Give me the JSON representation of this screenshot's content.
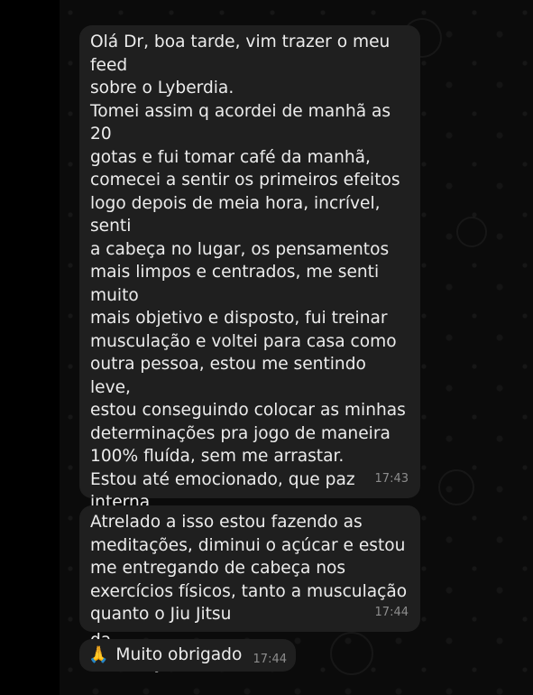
{
  "messages": [
    {
      "text": "Olá Dr, boa tarde, vim trazer o meu feed\nsobre o Lyberdia.\nTomei assim q acordei de manhã as 20\ngotas e fui tomar café da manhã,\ncomecei a sentir os primeiros efeitos\nlogo depois de meia hora, incrível, senti\na cabeça no lugar, os pensamentos\nmais limpos e centrados, me senti muito\nmais objetivo e disposto, fui treinar\nmusculação e voltei para casa como\noutra pessoa, estou me sentindo leve,\nestou conseguindo colocar as minhas\ndeterminações pra jogo de maneira\n100% fluída, sem me arrastar.\nEstou até emocionado, que paz interna\nestou sentindo agora, estou pleno e\nfocado, parece que estava faltando uma\npecinha nas engrenagens do meu\ncérebro. Muito feliz com o resultado da\nmedicação",
      "time": "17:43"
    },
    {
      "text": "Atrelado a isso estou fazendo as\nmeditações,  diminui o açúcar e estou\nme entregando de cabeça nos\nexercícios físicos, tanto a musculação\nquanto o Jiu Jitsu",
      "time": "17:44"
    },
    {
      "emoji": "🙏",
      "text": "Muito obrigado",
      "time": "17:44"
    }
  ]
}
